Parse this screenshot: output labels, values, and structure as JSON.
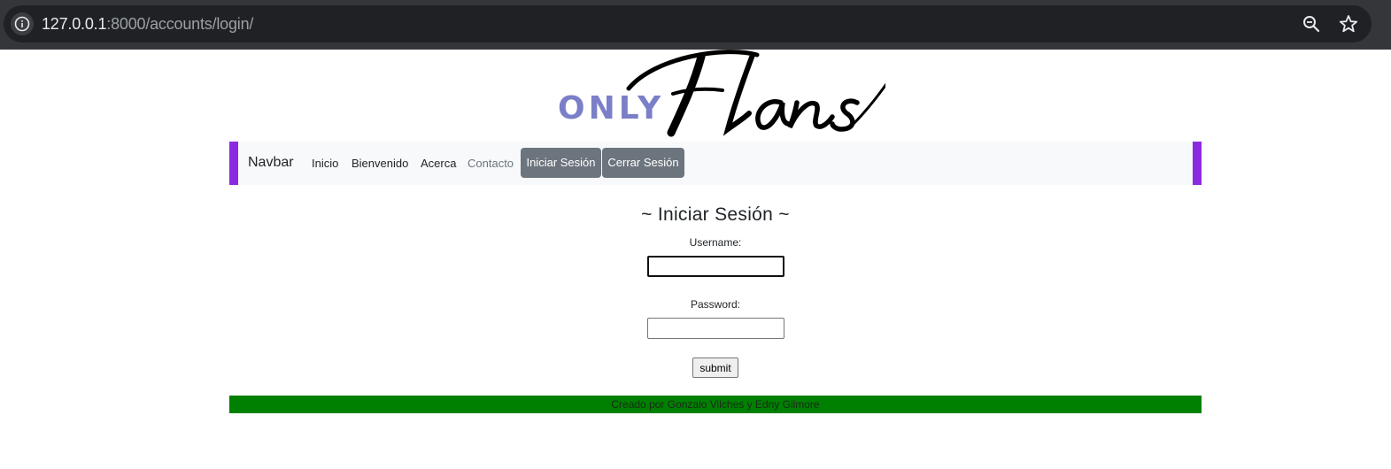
{
  "browser": {
    "url_host": "127.0.0.1",
    "url_rest": ":8000/accounts/login/"
  },
  "logo": {
    "only": "ONLY",
    "flans": "Flans"
  },
  "navbar": {
    "brand": "Navbar",
    "links": [
      "Inicio",
      "Bienvenido",
      "Acerca",
      "Contacto"
    ],
    "buttons": [
      "Iniciar Sesión",
      "Cerrar Sesión"
    ],
    "accent_color": "#8a2be2",
    "button_color": "#6c757d"
  },
  "login": {
    "title": "~ Iniciar Sesión ~",
    "username_label": "Username:",
    "username_value": "",
    "password_label": "Password:",
    "password_value": "",
    "submit_label": "submit"
  },
  "footer": {
    "text": "Creado por Gonzalo Vilches y Edny Gilmore",
    "color": "#008000"
  }
}
